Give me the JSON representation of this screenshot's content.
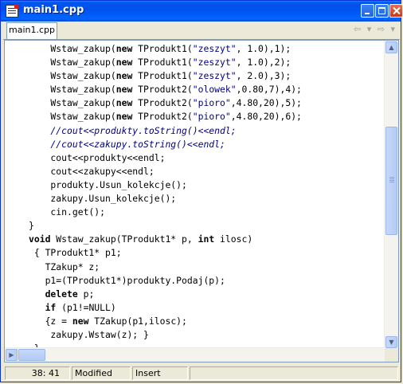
{
  "window": {
    "title": "main1.cpp"
  },
  "tab": {
    "label": "main1.cpp"
  },
  "code_lines": [
    [
      {
        "t": "    Wstaw_zakup("
      },
      {
        "t": "new",
        "c": "kw"
      },
      {
        "t": " TProdukt1("
      },
      {
        "t": "\"zeszyt\"",
        "c": "str"
      },
      {
        "t": ", 1.0),1);"
      }
    ],
    [
      {
        "t": "    Wstaw_zakup("
      },
      {
        "t": "new",
        "c": "kw"
      },
      {
        "t": " TProdukt1("
      },
      {
        "t": "\"zeszyt\"",
        "c": "str"
      },
      {
        "t": ", 1.0),2);"
      }
    ],
    [
      {
        "t": "    Wstaw_zakup("
      },
      {
        "t": "new",
        "c": "kw"
      },
      {
        "t": " TProdukt1("
      },
      {
        "t": "\"zeszyt\"",
        "c": "str"
      },
      {
        "t": ", 2.0),3);"
      }
    ],
    [
      {
        "t": "    Wstaw_zakup("
      },
      {
        "t": "new",
        "c": "kw"
      },
      {
        "t": " TProdukt2("
      },
      {
        "t": "\"olowek\"",
        "c": "str"
      },
      {
        "t": ",0.80,7),4);"
      }
    ],
    [
      {
        "t": "    Wstaw_zakup("
      },
      {
        "t": "new",
        "c": "kw"
      },
      {
        "t": " TProdukt2("
      },
      {
        "t": "\"pioro\"",
        "c": "str"
      },
      {
        "t": ",4.80,20),5);"
      }
    ],
    [
      {
        "t": "    Wstaw_zakup("
      },
      {
        "t": "new",
        "c": "kw"
      },
      {
        "t": " TProdukt2("
      },
      {
        "t": "\"pioro\"",
        "c": "str"
      },
      {
        "t": ",4.80,20),6);"
      }
    ],
    [
      {
        "t": "    //cout<<produkty.toString()<<endl;",
        "c": "cmt"
      }
    ],
    [
      {
        "t": "    //cout<<zakupy.toString()<<endl;",
        "c": "cmt"
      }
    ],
    [
      {
        "t": "    cout<<produkty<<endl;"
      }
    ],
    [
      {
        "t": "    cout<<zakupy<<endl;"
      }
    ],
    [
      {
        "t": "    produkty.Usun_kolekcje();"
      }
    ],
    [
      {
        "t": "    zakupy.Usun_kolekcje();"
      }
    ],
    [
      {
        "t": "    cin.get();"
      }
    ],
    [
      {
        "t": "}"
      }
    ],
    [
      {
        "t": "void",
        "c": "kw"
      },
      {
        "t": " Wstaw_zakup(TProdukt1* p, "
      },
      {
        "t": "int",
        "c": "kw"
      },
      {
        "t": " ilosc)"
      }
    ],
    [
      {
        "t": " { TProdukt1* p1;"
      }
    ],
    [
      {
        "t": "   TZakup* z;"
      }
    ],
    [
      {
        "t": "   p1=(TProdukt1*)produkty.Podaj(p);"
      }
    ],
    [
      {
        "t": "   "
      },
      {
        "t": "delete",
        "c": "kw"
      },
      {
        "t": " p;"
      }
    ],
    [
      {
        "t": "   "
      },
      {
        "t": "if",
        "c": "kw"
      },
      {
        "t": " (p1!=NULL)"
      }
    ],
    [
      {
        "t": "   {z = "
      },
      {
        "t": "new",
        "c": "kw"
      },
      {
        "t": " TZakup(p1,ilosc);"
      }
    ],
    [
      {
        "t": "    zakupy.Wstaw(z); }"
      }
    ],
    [
      {
        "t": " }"
      }
    ]
  ],
  "statusbar": {
    "position": "38:  41",
    "modified": "Modified",
    "mode": "Insert",
    "extra": ""
  },
  "colors": {
    "titlebar": "#0053ee",
    "keyword": "#000000",
    "string": "#000080",
    "comment": "#000080",
    "background": "#ffffff"
  },
  "icons": {
    "app": "document-icon",
    "minimize": "minimize-icon",
    "maximize": "maximize-icon",
    "close": "close-icon",
    "nav_back": "arrow-left-icon",
    "nav_forward": "arrow-right-icon"
  }
}
